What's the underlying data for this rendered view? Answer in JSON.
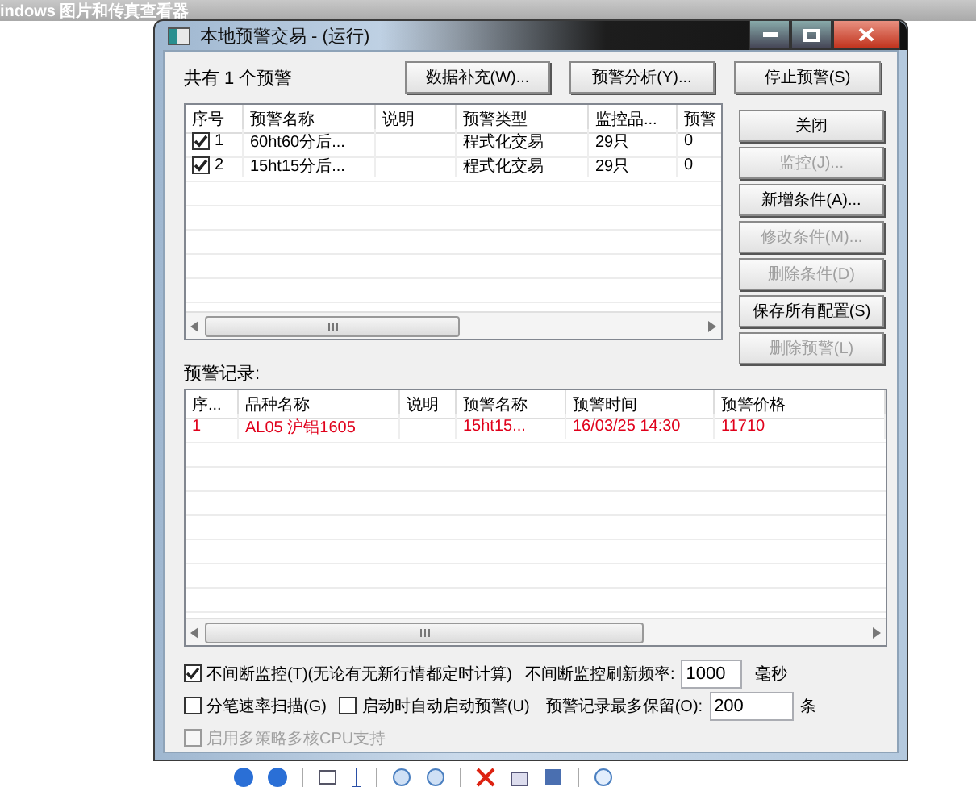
{
  "viewer": {
    "title": "indows 图片和传真查看器"
  },
  "dialog": {
    "title": "本地预警交易 - (运行)",
    "alert_count": "共有 1 个预警",
    "top_buttons": [
      {
        "label": "数据补充(W)...",
        "disabled": false
      },
      {
        "label": "预警分析(Y)...",
        "disabled": false
      },
      {
        "label": "停止预警(S)",
        "disabled": false
      }
    ],
    "side_buttons": [
      {
        "label": "关闭",
        "disabled": false
      },
      {
        "label": "监控(J)...",
        "disabled": true
      },
      {
        "label": "新增条件(A)...",
        "disabled": false
      },
      {
        "label": "修改条件(M)...",
        "disabled": true
      },
      {
        "label": "删除条件(D)",
        "disabled": true
      },
      {
        "label": "保存所有配置(S)",
        "disabled": false
      },
      {
        "label": "删除预警(L)",
        "disabled": true
      }
    ],
    "alerts": {
      "columns": [
        "序号",
        "预警名称",
        "说明",
        "预警类型",
        "监控品...",
        "预警"
      ],
      "rows": [
        {
          "checked": true,
          "index": "1",
          "name": "60ht60分后...",
          "type": "程式化交易",
          "monitored": "29只",
          "count": "0"
        },
        {
          "checked": true,
          "index": "2",
          "name": "15ht15分后...",
          "type": "程式化交易",
          "monitored": "29只",
          "count": "0"
        }
      ]
    },
    "records_label": "预警记录:",
    "records": {
      "columns": [
        "序...",
        "品种名称",
        "说明",
        "预警名称",
        "预警时间",
        "预警价格"
      ],
      "rows": [
        {
          "index": "1",
          "symbol": "AL05 沪铝1605",
          "alert_name": "15ht15...",
          "time": "16/03/25 14:30",
          "price": "11710"
        }
      ]
    },
    "options": [
      {
        "label": "不间断监控(T)(无论有无新行情都定时计算)",
        "checked": true,
        "disabled": false
      },
      {
        "label": "分笔速率扫描(G)",
        "checked": false,
        "disabled": false
      },
      {
        "label": "启动时自动启动预警(U)",
        "checked": false,
        "disabled": false
      },
      {
        "label": "启用多策略多核CPU支持",
        "checked": false,
        "disabled": true
      }
    ],
    "refresh": {
      "label": "不间断监控刷新频率:",
      "value": "1000",
      "unit": "毫秒"
    },
    "keep": {
      "label": "预警记录最多保留(O):",
      "value": "200",
      "unit": "条"
    }
  }
}
